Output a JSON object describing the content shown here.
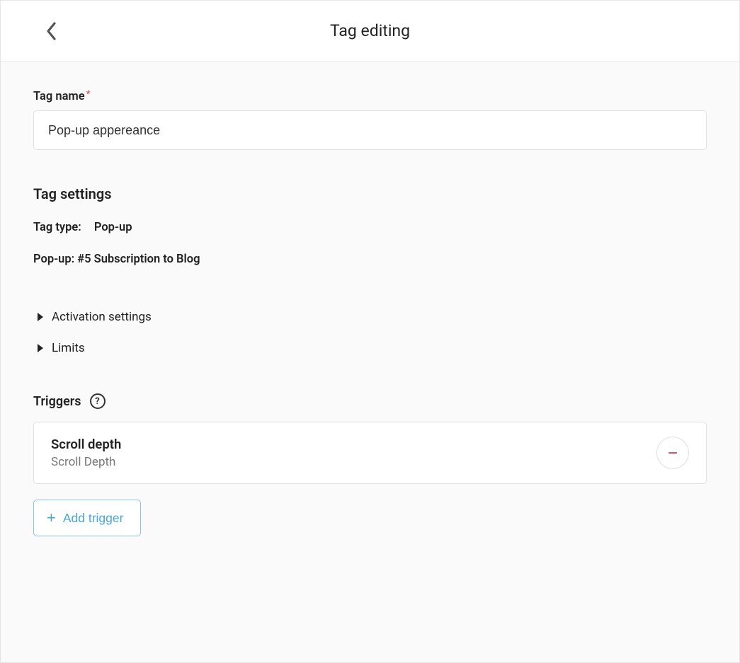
{
  "header": {
    "title": "Tag editing"
  },
  "form": {
    "tag_name_label": "Tag name",
    "tag_name_value": "Pop-up appereance"
  },
  "settings": {
    "title": "Tag settings",
    "tag_type_key": "Tag type:",
    "tag_type_value": "Pop-up",
    "popup_line": "Pop-up: #5 Subscription to Blog",
    "collapsibles": {
      "activation": "Activation settings",
      "limits": "Limits"
    }
  },
  "triggers": {
    "title": "Triggers",
    "items": [
      {
        "name": "Scroll depth",
        "type": "Scroll Depth"
      }
    ],
    "add_label": "Add trigger"
  }
}
